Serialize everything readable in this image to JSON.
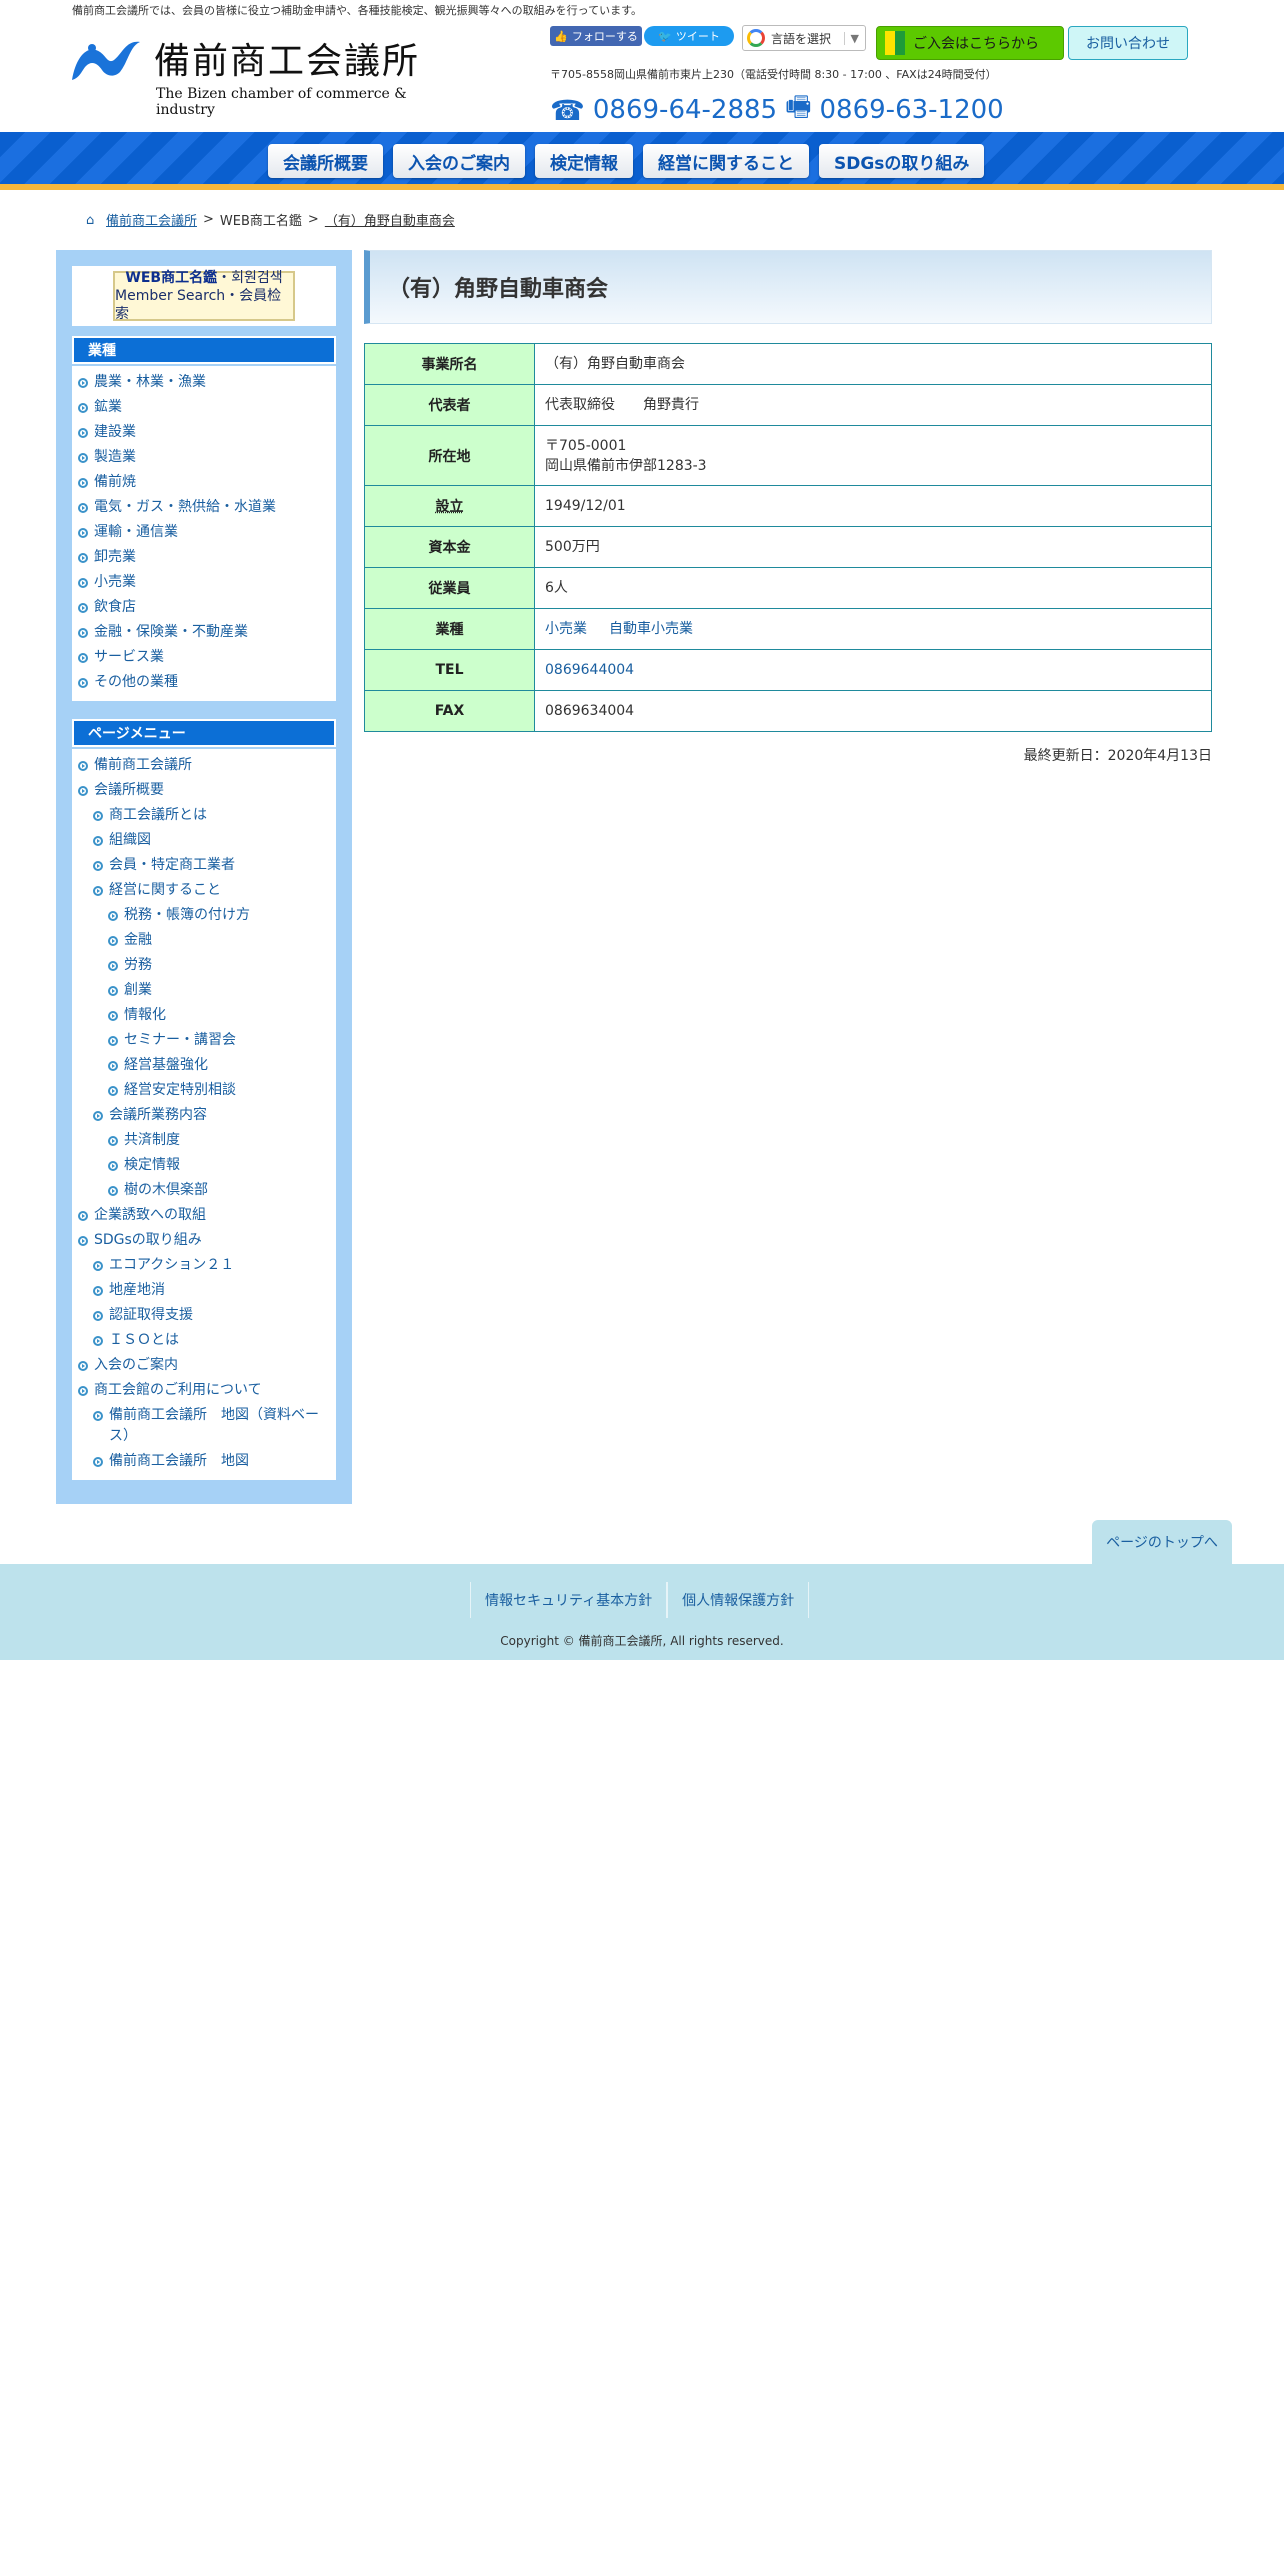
{
  "header": {
    "tagline": "備前商工会議所では、会員の皆様に役立つ補助金申請や、各種技能検定、観光振興等々への取組みを行っています。",
    "logo_jp": "備前商工会議所",
    "logo_en": "The Bizen chamber of commerce & industry",
    "follow_label": "フォローする",
    "tweet_label": "ツイート",
    "lang_label": "言語を選択",
    "join_label": "ご入会はこちらから",
    "contact_label": "お問い合わせ",
    "address": "〒705-8558岡山県備前市東片上230（電話受付時間 8:30 - 17:00 、FAXは24時間受付）",
    "tel": "0869-64-2885",
    "fax": "0869-63-1200",
    "brand_color": "#0c6fd6",
    "accent_color": "#f6b73c"
  },
  "nav": {
    "items": [
      "会議所概要",
      "入会のご案内",
      "検定情報",
      "経営に関すること",
      "SDGsの取り組み"
    ]
  },
  "breadcrumb": {
    "home": "備前商工会議所",
    "section": "WEB商工名鑑",
    "current": "（有）角野自動車商会"
  },
  "sidebar": {
    "banner_line1_bold": "WEB商工名鑑",
    "banner_line1_rest": "・회원검색",
    "banner_line2": "Member Search・会員检索",
    "industry_heading": "業種",
    "industries": [
      "農業・林業・漁業",
      "鉱業",
      "建設業",
      "製造業",
      "備前焼",
      "電気・ガス・熱供給・水道業",
      "運輸・通信業",
      "卸売業",
      "小売業",
      "飲食店",
      "金融・保険業・不動産業",
      "サービス業",
      "その他の業種"
    ],
    "page_menu_heading": "ページメニュー",
    "page_menu": [
      {
        "label": "備前商工会議所",
        "level": 0
      },
      {
        "label": "会議所概要",
        "level": 0
      },
      {
        "label": "商工会議所とは",
        "level": 1
      },
      {
        "label": "組織図",
        "level": 1
      },
      {
        "label": "会員・特定商工業者",
        "level": 1
      },
      {
        "label": "経営に関すること",
        "level": 1
      },
      {
        "label": "税務・帳簿の付け方",
        "level": 2
      },
      {
        "label": "金融",
        "level": 2
      },
      {
        "label": "労務",
        "level": 2
      },
      {
        "label": "創業",
        "level": 2
      },
      {
        "label": "情報化",
        "level": 2
      },
      {
        "label": "セミナー・講習会",
        "level": 2
      },
      {
        "label": "経営基盤強化",
        "level": 2
      },
      {
        "label": "経営安定特別相談",
        "level": 2
      },
      {
        "label": "会議所業務内容",
        "level": 1
      },
      {
        "label": "共済制度",
        "level": 2
      },
      {
        "label": "検定情報",
        "level": 2
      },
      {
        "label": "樹の木倶楽部",
        "level": 2
      },
      {
        "label": "企業誘致への取組",
        "level": 0
      },
      {
        "label": "SDGsの取り組み",
        "level": 0
      },
      {
        "label": "エコアクション２１",
        "level": 1
      },
      {
        "label": "地産地消",
        "level": 1
      },
      {
        "label": "認証取得支援",
        "level": 1
      },
      {
        "label": "ＩＳＯとは",
        "level": 1
      },
      {
        "label": "入会のご案内",
        "level": 0
      },
      {
        "label": "商工会館のご利用について",
        "level": 0
      },
      {
        "label": "備前商工会議所　地図（資料ベース）",
        "level": 1
      },
      {
        "label": "備前商工会議所　地図",
        "level": 1
      }
    ]
  },
  "main": {
    "title": "（有）角野自動車商会",
    "rows": {
      "name": {
        "label": "事業所名",
        "value": "（有）角野自動車商会"
      },
      "rep": {
        "label": "代表者",
        "value": "代表取締役　　角野貴行"
      },
      "address": {
        "label": "所在地",
        "postal": "〒705-0001",
        "value": "岡山県備前市伊部1283-3"
      },
      "founded": {
        "label": "設立",
        "value": "1949/12/01"
      },
      "capital": {
        "label": "資本金",
        "value": "500万円"
      },
      "employees": {
        "label": "従業員",
        "value": "6人"
      },
      "industry": {
        "label": "業種",
        "value1": "小売業",
        "value2": "自動車小売業"
      },
      "tel": {
        "label": "TEL",
        "value": "0869644004"
      },
      "fax": {
        "label": "FAX",
        "value": "0869634004"
      }
    },
    "updated": "最終更新日：2020年4月13日"
  },
  "footer": {
    "to_top": "ページのトップへ",
    "links": [
      "情報セキュリティ基本方針",
      "個人情報保護方針"
    ],
    "copyright": "Copyright © 備前商工会議所, All rights reserved."
  }
}
